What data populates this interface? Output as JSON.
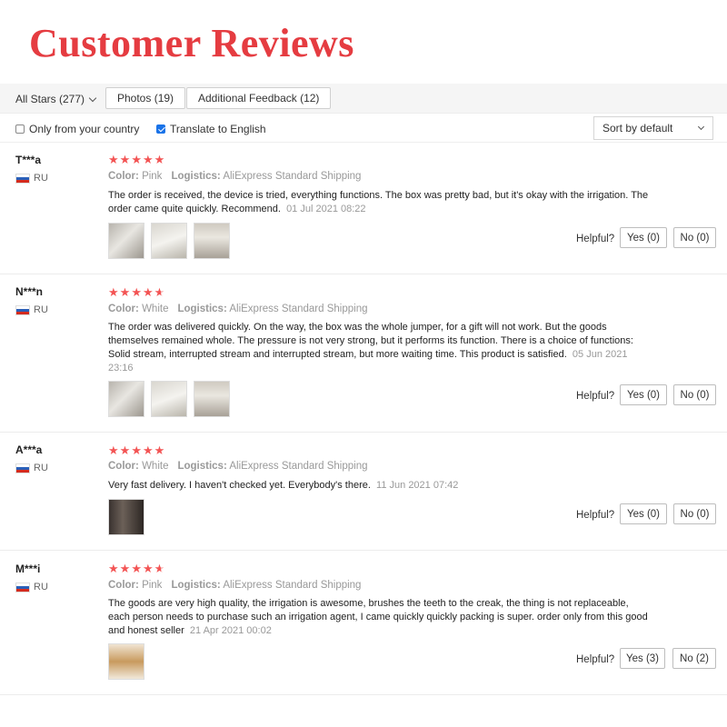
{
  "page_title": "Customer Reviews",
  "filters": {
    "all_stars": "All Stars (277)",
    "photos": "Photos (19)",
    "additional_feedback": "Additional Feedback (12)"
  },
  "options": {
    "only_country": "Only from your country",
    "only_country_checked": false,
    "translate": "Translate to English",
    "translate_checked": true,
    "sort": "Sort by default"
  },
  "colors": {
    "title_red": "#e53c41",
    "star_red": "#f35454",
    "checkbox_blue": "#1a73e8"
  },
  "reviews": [
    {
      "name": "T***a",
      "country": "RU",
      "rating": 5,
      "color_label": "Color:",
      "color": "Pink",
      "logistics_label": "Logistics:",
      "logistics": "AliExpress Standard Shipping",
      "text": "The order is received, the device is tried, everything functions. The box was pretty bad, but it's okay with the irrigation. The order came quite quickly. Recommend.",
      "date": "01 Jul 2021 08:22",
      "photo_count": 3,
      "helpful": "Helpful?",
      "yes": "Yes (0)",
      "no": "No (0)"
    },
    {
      "name": "N***n",
      "country": "RU",
      "rating": 4.5,
      "color_label": "Color:",
      "color": "White",
      "logistics_label": "Logistics:",
      "logistics": "AliExpress Standard Shipping",
      "text": "The order was delivered quickly. On the way, the box was the whole jumper, for a gift will not work. But the goods themselves remained whole. The pressure is not very strong, but it performs its function. There is a choice of functions: Solid stream, interrupted stream and interrupted stream, but more waiting time. This product is satisfied.",
      "date": "05 Jun 2021 23:16",
      "photo_count": 3,
      "helpful": "Helpful?",
      "yes": "Yes (0)",
      "no": "No (0)"
    },
    {
      "name": "A***a",
      "country": "RU",
      "rating": 5,
      "color_label": "Color:",
      "color": "White",
      "logistics_label": "Logistics:",
      "logistics": "AliExpress Standard Shipping",
      "text": "Very fast delivery. I haven't checked yet. Everybody's there.",
      "date": "11 Jun 2021 07:42",
      "photo_count": 1,
      "helpful": "Helpful?",
      "yes": "Yes (0)",
      "no": "No (0)"
    },
    {
      "name": "M***i",
      "country": "RU",
      "rating": 4.5,
      "color_label": "Color:",
      "color": "Pink",
      "logistics_label": "Logistics:",
      "logistics": "AliExpress Standard Shipping",
      "text": "The goods are very high quality, the irrigation is awesome, brushes the teeth to the creak, the thing is not replaceable, each person needs to purchase such an irrigation agent, I came quickly quickly packing is super. order only from this good and honest seller",
      "date": "21 Apr 2021 00:02",
      "photo_count": 1,
      "helpful": "Helpful?",
      "yes": "Yes (3)",
      "no": "No (2)"
    }
  ]
}
